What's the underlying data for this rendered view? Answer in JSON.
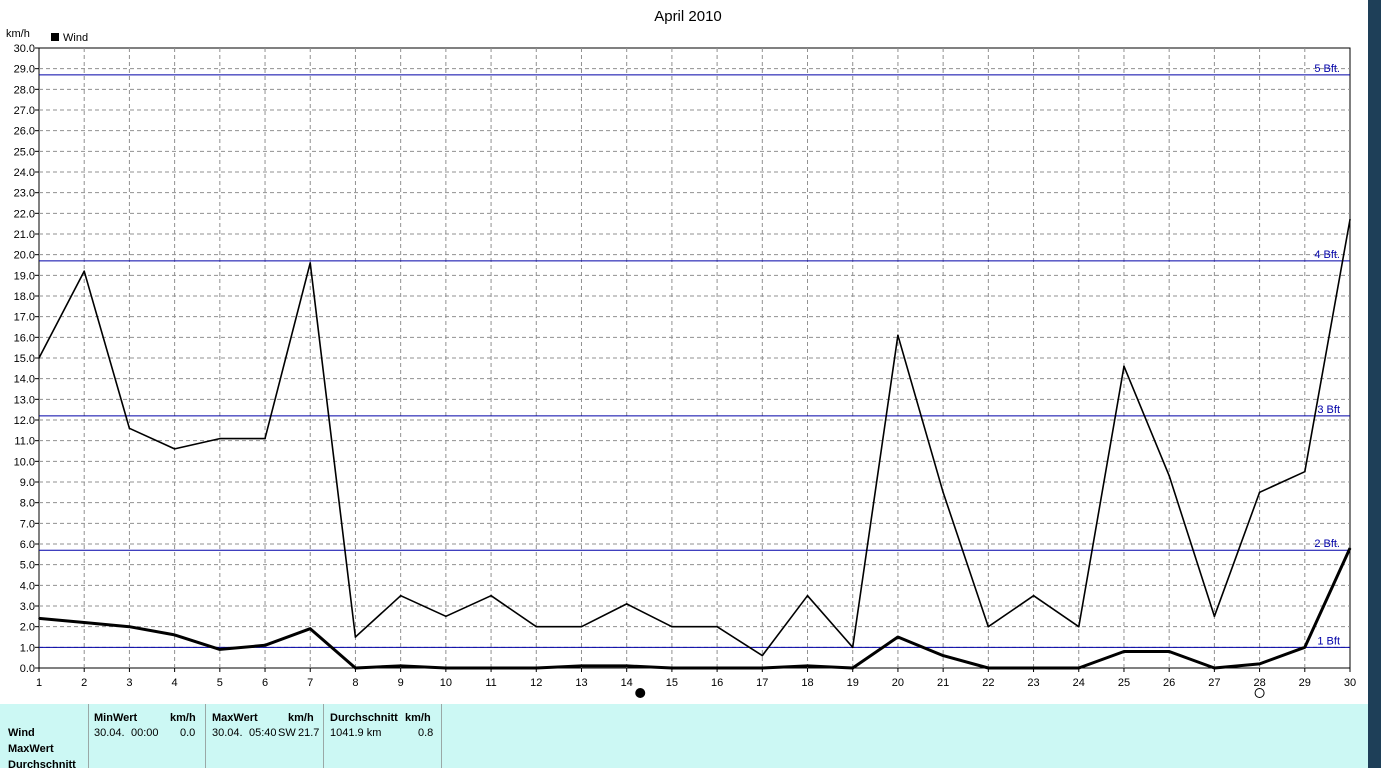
{
  "chart_data": {
    "type": "line",
    "title": "April 2010",
    "ylabel": "km/h",
    "xlabel": "",
    "x": [
      1,
      2,
      3,
      4,
      5,
      6,
      7,
      8,
      9,
      10,
      11,
      12,
      13,
      14,
      15,
      16,
      17,
      18,
      19,
      20,
      21,
      22,
      23,
      24,
      25,
      26,
      27,
      28,
      29,
      30
    ],
    "x_tick_labels": [
      "1",
      "2",
      "3",
      "4",
      "5",
      "6",
      "7",
      "8",
      "9",
      "10",
      "11",
      "12",
      "13",
      "14",
      "15",
      "16",
      "17",
      "18",
      "19",
      "20",
      "21",
      "22",
      "23",
      "24",
      "25",
      "26",
      "27",
      "28",
      "29",
      "30"
    ],
    "ylim": [
      0,
      30
    ],
    "y_tick_labels": [
      "0.0",
      "1.0",
      "2.0",
      "3.0",
      "4.0",
      "5.0",
      "6.0",
      "7.0",
      "8.0",
      "9.0",
      "10.0",
      "11.0",
      "12.0",
      "13.0",
      "14.0",
      "15.0",
      "16.0",
      "17.0",
      "18.0",
      "19.0",
      "20.0",
      "21.0",
      "22.0",
      "23.0",
      "24.0",
      "25.0",
      "26.0",
      "27.0",
      "28.0",
      "29.0",
      "30.0"
    ],
    "grid": true,
    "legend": {
      "position": "top-left",
      "entries": [
        "Wind"
      ]
    },
    "series": [
      {
        "name": "Wind",
        "values": [
          2.4,
          2.2,
          2.0,
          1.6,
          0.9,
          1.1,
          1.9,
          0.0,
          0.1,
          0.0,
          0.0,
          0.0,
          0.1,
          0.1,
          0.0,
          0.0,
          0.0,
          0.1,
          0.0,
          1.5,
          0.6,
          0.0,
          0.0,
          0.0,
          0.8,
          0.8,
          0.0,
          0.2,
          1.0,
          5.8
        ]
      },
      {
        "values": [
          15.0,
          19.2,
          11.6,
          10.6,
          11.1,
          11.1,
          19.6,
          1.5,
          3.5,
          2.5,
          3.5,
          2.0,
          2.0,
          3.1,
          2.0,
          2.0,
          0.6,
          3.5,
          1.0,
          16.1,
          8.5,
          2.0,
          3.5,
          2.0,
          14.6,
          9.3,
          2.5,
          8.5,
          9.5,
          21.7
        ]
      }
    ],
    "reference_lines": [
      {
        "label": "1 Bft",
        "value": 1.0
      },
      {
        "label": "2 Bft.",
        "value": 5.7
      },
      {
        "label": "3 Bft",
        "value": 12.2
      },
      {
        "label": "4 Bft.",
        "value": 19.7
      },
      {
        "label": "5 Bft.",
        "value": 28.7
      }
    ],
    "moon_phases": [
      {
        "phase": "full-moon",
        "x": 14.3
      },
      {
        "phase": "new-moon",
        "x": 28.0
      }
    ]
  },
  "stats": {
    "row_labels": [
      "Wind",
      "MaxWert",
      "Durchschnitt"
    ],
    "min": {
      "header": "MinWert",
      "unit": "km/h",
      "date": "30.04.",
      "time": "00:00",
      "value": "0.0"
    },
    "max": {
      "header": "MaxWert",
      "unit": "km/h",
      "date": "30.04.",
      "time": "05:40",
      "dir": "SW",
      "value": "21.7"
    },
    "avg": {
      "header": "Durchschnitt",
      "unit": "km/h",
      "distance": "1041.9 km",
      "value": "0.8"
    }
  },
  "colors": {
    "reference": "#0000a8",
    "series": "#000000",
    "grid": "#909090",
    "panel": "#ccf8f4",
    "strip": "#1e3f58"
  }
}
